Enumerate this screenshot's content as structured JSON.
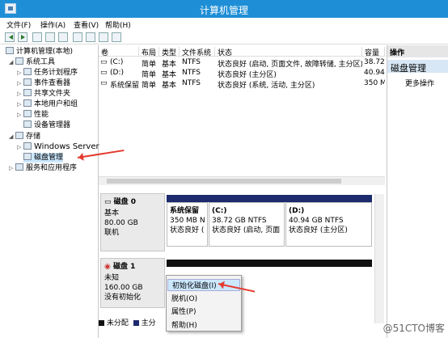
{
  "window": {
    "title": "计算机管理"
  },
  "menu": [
    "文件(F)",
    "操作(A)",
    "查看(V)",
    "帮助(H)"
  ],
  "tree": {
    "root": "计算机管理(本地)",
    "system_tools": "系统工具",
    "task_scheduler": "任务计划程序",
    "event_viewer": "事件查看器",
    "shared_folders": "共享文件夹",
    "local_users": "本地用户和组",
    "performance": "性能",
    "device_manager": "设备管理器",
    "storage": "存储",
    "windows_server": "Windows Server",
    "disk_management": "磁盘管理",
    "services": "服务和应用程序"
  },
  "columns": [
    "卷",
    "布局",
    "类型",
    "文件系统",
    "状态",
    "容量"
  ],
  "volumes": [
    {
      "name": "(C:)",
      "layout": "简单",
      "type": "基本",
      "fs": "NTFS",
      "status": "状态良好 (启动, 页面文件, 故障转储, 主分区)",
      "capacity": "38.72"
    },
    {
      "name": "(D:)",
      "layout": "简单",
      "type": "基本",
      "fs": "NTFS",
      "status": "状态良好 (主分区)",
      "capacity": "40.94"
    },
    {
      "name": "系统保留",
      "layout": "简单",
      "type": "基本",
      "fs": "NTFS",
      "status": "状态良好 (系统, 活动, 主分区)",
      "capacity": "350 M"
    }
  ],
  "actions": {
    "header": "操作",
    "selected": "磁盘管理",
    "more": "更多操作"
  },
  "disk0": {
    "name": "磁盘 0",
    "kind": "基本",
    "size": "80.00 GB",
    "state": "联机",
    "partitions": [
      {
        "label": "系统保留",
        "size": "350 MB N",
        "status": "状态良好 ("
      },
      {
        "label": "(C:)",
        "size": "38.72 GB NTFS",
        "status": "状态良好 (启动, 页面"
      },
      {
        "label": "(D:)",
        "size": "40.94 GB NTFS",
        "status": "状态良好 (主分区)"
      }
    ]
  },
  "disk1": {
    "name": "磁盘 1",
    "kind": "未知",
    "size": "160.00 GB",
    "state": "没有初始化"
  },
  "context_menu": [
    "初始化磁盘(I)",
    "脱机(O)",
    "属性(P)",
    "帮助(H)"
  ],
  "legend": {
    "unallocated": "未分配",
    "primary": "主分"
  },
  "watermark": "@51CTO博客"
}
